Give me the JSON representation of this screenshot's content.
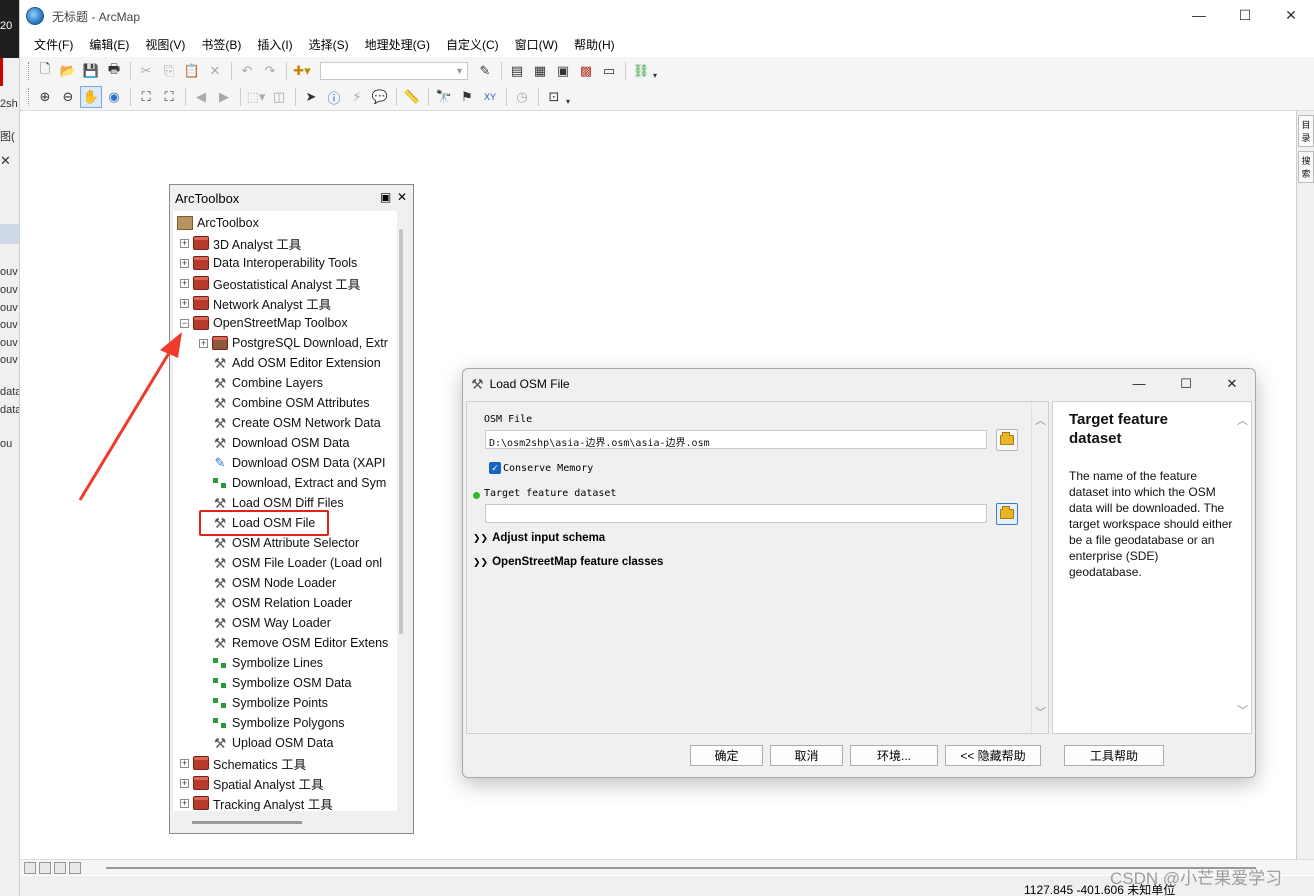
{
  "window": {
    "title": "无标题 - ArcMap"
  },
  "menubar": [
    "文件(F)",
    "编辑(E)",
    "视图(V)",
    "书签(B)",
    "插入(I)",
    "选择(S)",
    "地理处理(G)",
    "自定义(C)",
    "窗口(W)",
    "帮助(H)"
  ],
  "background_fragments": [
    "20",
    "2sh",
    "图(",
    "ouv",
    "ouv",
    "ouv",
    "ouv",
    "ouv",
    "ouv",
    "data",
    "data",
    "ou"
  ],
  "right_strip": [
    "目录",
    "搜索"
  ],
  "arctoolbox": {
    "title": "ArcToolbox",
    "root": "ArcToolbox",
    "items": [
      {
        "label": "3D Analyst 工具",
        "level": 1,
        "icon": "toolbox-icon",
        "expander": "+"
      },
      {
        "label": "Data Interoperability Tools",
        "level": 1,
        "icon": "toolbox-icon",
        "expander": "+"
      },
      {
        "label": "Geostatistical Analyst 工具",
        "level": 1,
        "icon": "toolbox-icon",
        "expander": "+"
      },
      {
        "label": "Network Analyst 工具",
        "level": 1,
        "icon": "toolbox-icon",
        "expander": "+"
      },
      {
        "label": "OpenStreetMap Toolbox",
        "level": 1,
        "icon": "toolbox-icon",
        "expander": "−"
      },
      {
        "label": "PostgreSQL Download, Extr",
        "level": 2,
        "icon": "toolset-icon",
        "expander": "+"
      },
      {
        "label": "Add OSM Editor Extension",
        "level": 2,
        "icon": "hammer-icon",
        "expander": ""
      },
      {
        "label": "Combine Layers",
        "level": 2,
        "icon": "hammer-icon",
        "expander": ""
      },
      {
        "label": "Combine OSM Attributes",
        "level": 2,
        "icon": "hammer-icon",
        "expander": ""
      },
      {
        "label": "Create OSM Network Data",
        "level": 2,
        "icon": "hammer-icon",
        "expander": ""
      },
      {
        "label": "Download OSM Data",
        "level": 2,
        "icon": "hammer-icon",
        "expander": ""
      },
      {
        "label": "Download OSM Data (XAPI",
        "level": 2,
        "icon": "script-icon",
        "expander": ""
      },
      {
        "label": "Download, Extract and Sym",
        "level": 2,
        "icon": "model-icon",
        "expander": ""
      },
      {
        "label": "Load OSM Diff Files",
        "level": 2,
        "icon": "hammer-icon",
        "expander": ""
      },
      {
        "label": "Load OSM File",
        "level": 2,
        "icon": "hammer-icon",
        "expander": ""
      },
      {
        "label": "OSM Attribute Selector",
        "level": 2,
        "icon": "hammer-icon",
        "expander": ""
      },
      {
        "label": "OSM File Loader (Load onl",
        "level": 2,
        "icon": "hammer-icon",
        "expander": ""
      },
      {
        "label": "OSM Node Loader",
        "level": 2,
        "icon": "hammer-icon",
        "expander": ""
      },
      {
        "label": "OSM Relation Loader",
        "level": 2,
        "icon": "hammer-icon",
        "expander": ""
      },
      {
        "label": "OSM Way Loader",
        "level": 2,
        "icon": "hammer-icon",
        "expander": ""
      },
      {
        "label": "Remove OSM Editor Extens",
        "level": 2,
        "icon": "hammer-icon",
        "expander": ""
      },
      {
        "label": "Symbolize Lines",
        "level": 2,
        "icon": "model-icon",
        "expander": ""
      },
      {
        "label": "Symbolize OSM Data",
        "level": 2,
        "icon": "model-icon",
        "expander": ""
      },
      {
        "label": "Symbolize Points",
        "level": 2,
        "icon": "model-icon",
        "expander": ""
      },
      {
        "label": "Symbolize Polygons",
        "level": 2,
        "icon": "model-icon",
        "expander": ""
      },
      {
        "label": "Upload OSM Data",
        "level": 2,
        "icon": "hammer-icon",
        "expander": ""
      },
      {
        "label": "Schematics 工具",
        "level": 1,
        "icon": "toolbox-icon",
        "expander": "+"
      },
      {
        "label": "Spatial Analyst 工具",
        "level": 1,
        "icon": "toolbox-icon",
        "expander": "+"
      },
      {
        "label": "Tracking Analyst 工具",
        "level": 1,
        "icon": "toolbox-icon",
        "expander": "+"
      }
    ]
  },
  "dialog": {
    "title": "Load OSM File",
    "osm_file_label": "OSM File",
    "osm_file_value": "D:\\osm2shp\\asia-边界.osm\\asia-边界.osm",
    "conserve_memory_label": "Conserve Memory",
    "conserve_memory_checked": true,
    "target_label": "Target feature dataset",
    "target_value": "",
    "section_adjust": "Adjust input schema",
    "section_classes": "OpenStreetMap feature classes",
    "help_title": "Target feature dataset",
    "help_body": "The name of the feature dataset into which the OSM data will be downloaded. The target workspace should either be a file geodatabase or an enterprise (SDE) geodatabase.",
    "buttons": {
      "ok": "确定",
      "cancel": "取消",
      "env": "环境...",
      "hide_help": "<< 隐藏帮助",
      "tool_help": "工具帮助"
    }
  },
  "status": {
    "coords": "1127.845  -401.606 未知单位"
  },
  "watermark": "CSDN @小芒果爱学习",
  "colors": {
    "highlight": "#e0231b",
    "arrow": "#f03a2e",
    "toolbox": "#b53a2b",
    "accent": "#1565c0"
  }
}
